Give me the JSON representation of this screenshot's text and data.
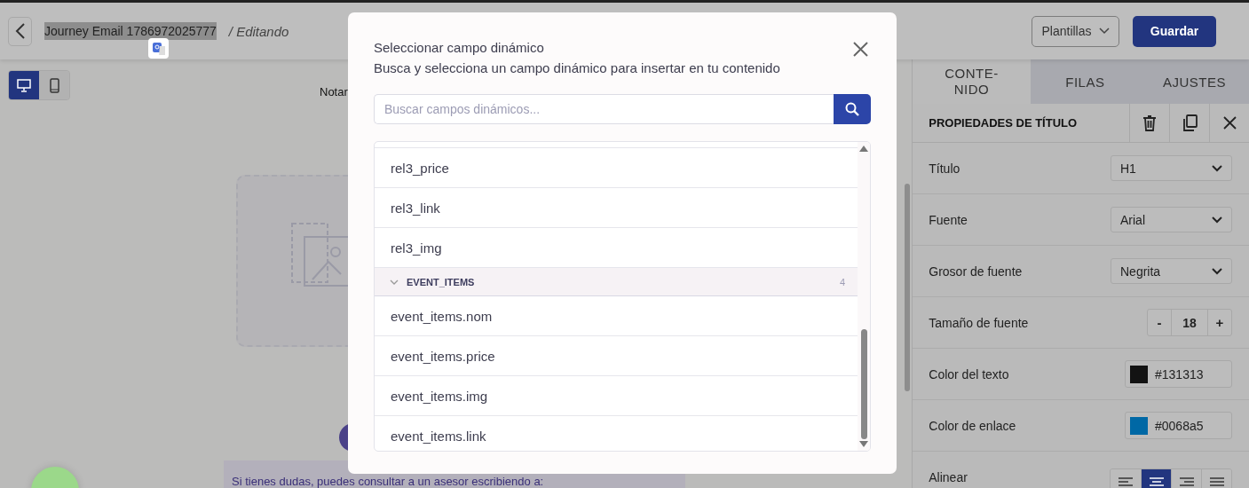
{
  "header": {
    "title": "Journey Email 1786972025777",
    "status": "/ Editando",
    "templates_button": "Plantillas",
    "save_button": "Guardar"
  },
  "device_toggle": [
    {
      "kind": "desktop",
      "selected": true
    },
    {
      "kind": "mobile",
      "selected": false
    }
  ],
  "canvas": {
    "heading_fragment": "Notar",
    "footer_text": "Si tienes dudas, puedes consultar a un asesor escribiendo a:"
  },
  "panel": {
    "tabs": [
      {
        "label": "CONTE-NIDO",
        "selected": true
      },
      {
        "label": "FILAS",
        "selected": false
      },
      {
        "label": "AJUSTES",
        "selected": false
      }
    ],
    "title": "PROPIEDADES DE TÍTULO",
    "properties": [
      {
        "kind": "select",
        "label": "Título",
        "value": "H1"
      },
      {
        "kind": "select",
        "label": "Fuente",
        "value": "Arial"
      },
      {
        "kind": "select",
        "label": "Grosor de fuente",
        "value": "Negrita"
      },
      {
        "kind": "stepper",
        "label": "Tamaño de fuente",
        "minus": "-",
        "value": "18",
        "plus": "+"
      },
      {
        "kind": "color",
        "label": "Color del texto",
        "value": "#131313",
        "color": "#131313"
      },
      {
        "kind": "color",
        "label": "Color de enlace",
        "value": "#0068a5",
        "color": "#0068a5"
      },
      {
        "kind": "align",
        "label": "Alinear",
        "options": [
          {
            "kind": "left",
            "selected": false
          },
          {
            "kind": "center",
            "selected": true
          },
          {
            "kind": "right",
            "selected": false
          },
          {
            "kind": "justify",
            "selected": false
          }
        ]
      }
    ]
  },
  "modal": {
    "title": "Seleccionar campo dinámico",
    "subtitle": "Busca y selecciona un campo dinámico para insertar en tu contenido",
    "search": {
      "placeholder": "Buscar campos dinámicos..."
    },
    "items": [
      {
        "kind": "field",
        "label": "rel3_price"
      },
      {
        "kind": "field",
        "label": "rel3_link"
      },
      {
        "kind": "field",
        "label": "rel3_img"
      },
      {
        "kind": "group",
        "label": "EVENT_ITEMS",
        "count": "4",
        "expanded": true
      },
      {
        "kind": "field",
        "label": "event_items.nom"
      },
      {
        "kind": "field",
        "label": "event_items.price"
      },
      {
        "kind": "field",
        "label": "event_items.img"
      },
      {
        "kind": "field",
        "label": "event_items.link"
      }
    ]
  }
}
